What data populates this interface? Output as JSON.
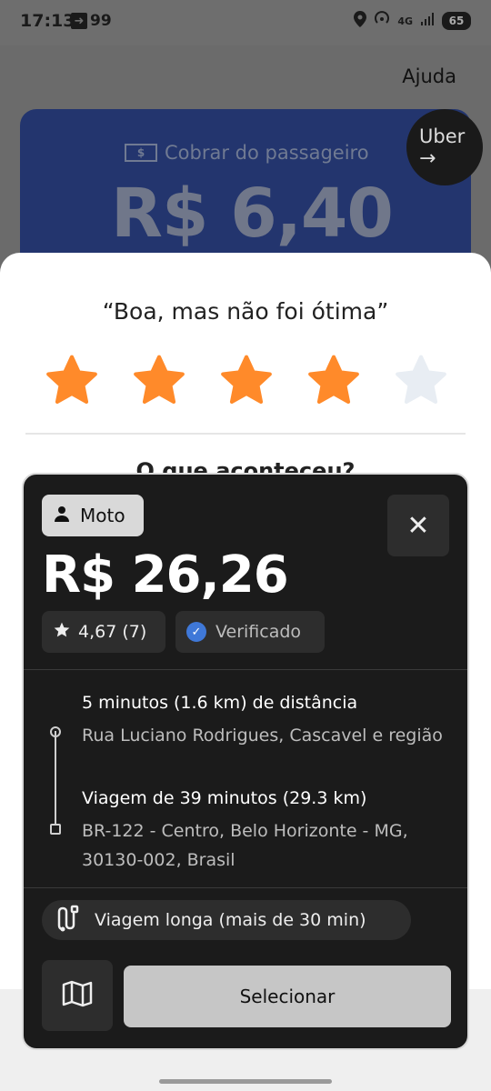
{
  "status_bar": {
    "time": "17:13",
    "nav_badge": "99",
    "network": "4G",
    "battery": "65"
  },
  "background": {
    "help_label": "Ajuda",
    "fare_label": "Cobrar do passageiro",
    "fare_amount": "R$ 6,40",
    "money_icon_text": "$",
    "uber_button_label": "Uber",
    "uber_button_arrow": "→"
  },
  "rating": {
    "title": "“Boa, mas não foi ótima”",
    "selected_stars": 4,
    "max_stars": 5,
    "question": "O que aconteceu?",
    "colors": {
      "star_active": "#ff8a2a",
      "star_inactive": "#e8edf3"
    }
  },
  "offer": {
    "vehicle_type": "Moto",
    "close_symbol": "✕",
    "price": "R$ 26,26",
    "rating": "4,67 (7)",
    "verified_label": "Verificado",
    "pickup_eta": "5 minutos (1.6 km) de distância",
    "pickup_address": "Rua Luciano Rodrigues, Cascavel e região",
    "trip_duration": "Viagem de 39 minutos (29.3 km)",
    "dropoff_address": "BR-122 - Centro, Belo Horizonte - MG, 30130-002, Brasil",
    "long_trip_label": "Viagem longa (mais de 30 min)",
    "select_label": "Selecionar",
    "colors": {
      "card": "#1b1b1b",
      "verified": "#3f78d8",
      "select_button": "#c6c6c6"
    }
  },
  "icons": {
    "person": "person-icon",
    "close": "close-icon",
    "star": "star-icon",
    "verified": "verified-badge-icon",
    "route": "route-icon",
    "map": "map-icon"
  }
}
